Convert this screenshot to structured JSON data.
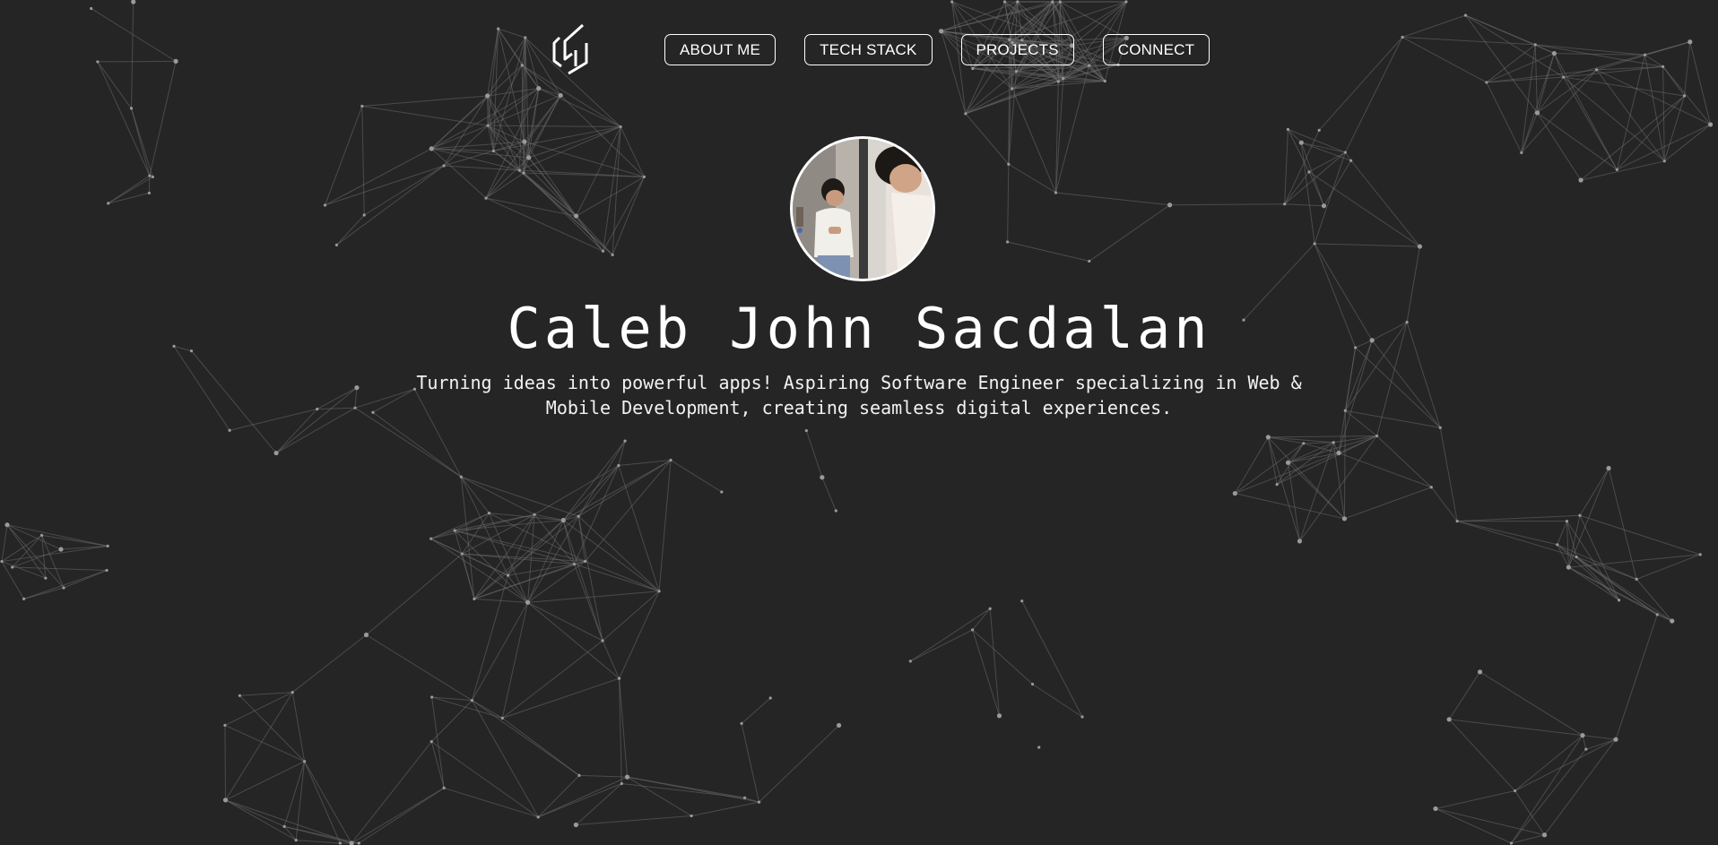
{
  "header": {
    "logo_icon": "cj-monogram-logo",
    "nav": [
      {
        "label": "ABOUT ME"
      },
      {
        "label": "TECH STACK"
      },
      {
        "label": "PROJECTS"
      },
      {
        "label": "CONNECT"
      }
    ]
  },
  "hero": {
    "name": "Caleb John Sacdalan",
    "tagline": "Turning ideas into powerful apps! Aspiring Software Engineer specializing in Web & Mobile Development, creating seamless digital experiences.",
    "avatar": "profile-photo"
  },
  "colors": {
    "background": "#252525",
    "foreground": "#ffffff",
    "network_line": "#6a6a6a",
    "network_node": "#9a9a9a"
  }
}
